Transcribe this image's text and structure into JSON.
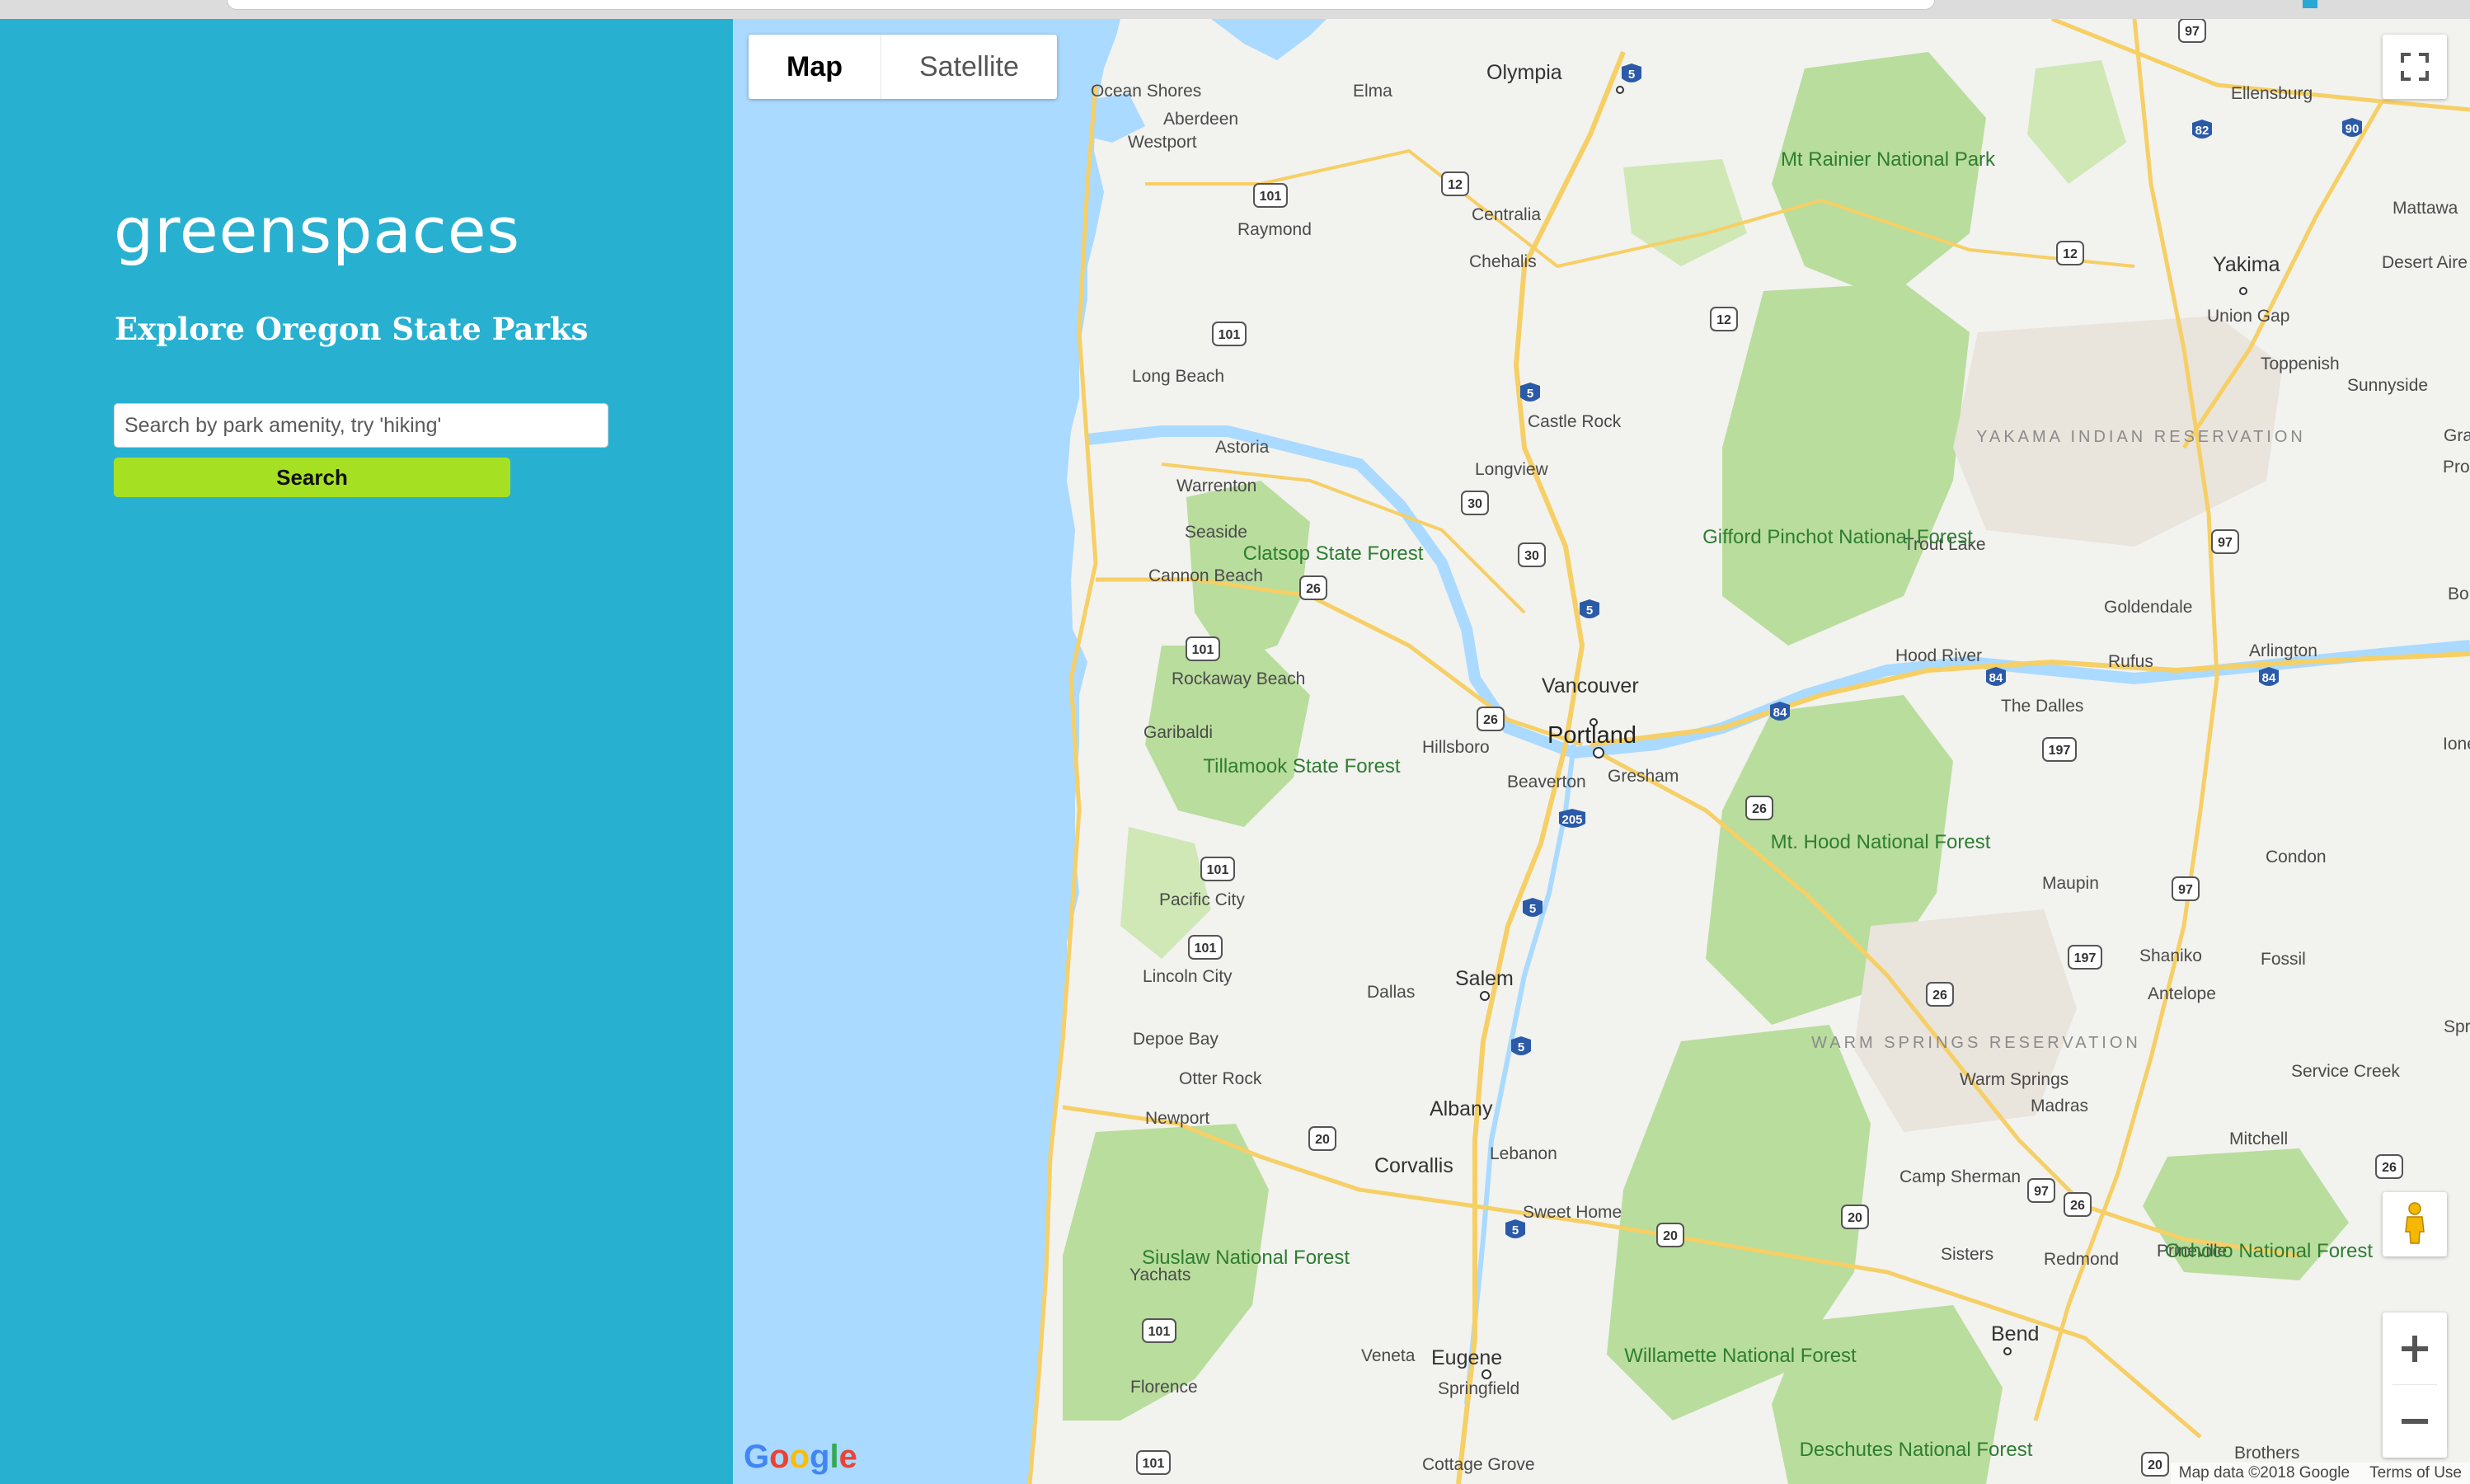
{
  "app": {
    "title": "greenspaces",
    "subtitle": "Explore Oregon State Parks"
  },
  "search": {
    "placeholder": "Search by park amenity, try 'hiking'",
    "value": "",
    "button_label": "Search"
  },
  "map": {
    "type_control": {
      "map_label": "Map",
      "satellite_label": "Satellite",
      "selected": "Map"
    },
    "attribution": {
      "map_data": "Map data ©2018 Google",
      "terms": "Terms of Use"
    },
    "logo_text": "Google",
    "labels": {
      "portland": "Portland",
      "salem": "Salem",
      "eugene": "Eugene",
      "vancouver": "Vancouver",
      "olympia": "Olympia",
      "yakima": "Yakima",
      "bend": "Bend",
      "albany": "Albany",
      "corvallis": "Corvallis",
      "beaverton": "Beaverton",
      "hillsboro": "Hillsboro",
      "gresham": "Gresham",
      "springfield": "Springfield",
      "ocean_shores": "Ocean Shores",
      "aberdeen": "Aberdeen",
      "elma": "Elma",
      "westport": "Westport",
      "raymond": "Raymond",
      "centralia": "Centralia",
      "chehalis": "Chehalis",
      "long_beach": "Long Beach",
      "castle_rock": "Castle Rock",
      "astoria": "Astoria",
      "warrenton": "Warrenton",
      "longview": "Longview",
      "seaside": "Seaside",
      "cannon_beach": "Cannon Beach",
      "rockaway_beach": "Rockaway Beach",
      "garibaldi": "Garibaldi",
      "pacific_city": "Pacific City",
      "lincoln_city": "Lincoln City",
      "depoe_bay": "Depoe Bay",
      "otter_rock": "Otter Rock",
      "newport": "Newport",
      "yachats": "Yachats",
      "florence": "Florence",
      "dallas": "Dallas",
      "lebanon": "Lebanon",
      "sweet_home": "Sweet Home",
      "veneta": "Veneta",
      "cottage_grove": "Cottage Grove",
      "ellensburg": "Ellensburg",
      "mattawa": "Mattawa",
      "desert_aire": "Desert Aire",
      "union_gap": "Union Gap",
      "toppenish": "Toppenish",
      "sunnyside": "Sunnyside",
      "trout_lake": "Trout Lake",
      "goldendale": "Goldendale",
      "hood_river": "Hood River",
      "the_dalles": "The Dalles",
      "rufus": "Rufus",
      "arlington": "Arlington",
      "condon": "Condon",
      "maupin": "Maupin",
      "shaniko": "Shaniko",
      "fossil": "Fossil",
      "antelope": "Antelope",
      "warm_springs": "Warm Springs",
      "madras": "Madras",
      "service_creek": "Service Creek",
      "mitchell": "Mitchell",
      "camp_sherman": "Camp Sherman",
      "sisters": "Sisters",
      "redmond": "Redmond",
      "prineville": "Prineville",
      "brothers": "Brothers",
      "gran": "Gran",
      "pro": "Pro",
      "bo": "Bo",
      "ione": "Ione",
      "spra": "Spra",
      "mt_rainier": "Mt Rainier National Park",
      "gifford_pinchot": "Gifford Pinchot National Forest",
      "clatsop": "Clatsop State Forest",
      "tillamook": "Tillamook State Forest",
      "mt_hood": "Mt. Hood National Forest",
      "siuslaw": "Siuslaw National Forest",
      "willamette": "Willamette National Forest",
      "deschutes": "Deschutes National Forest",
      "ochoco": "Ochoco National Forest",
      "yakama": "YAKAMA INDIAN RESERVATION",
      "warm_springs_res": "WARM SPRINGS RESERVATION"
    }
  },
  "colors": {
    "sidebar": "#28b0d1",
    "search_button": "#a6e022",
    "water": "#aadaff",
    "forest": "#b9dd9d",
    "road": "#f6cf65"
  }
}
